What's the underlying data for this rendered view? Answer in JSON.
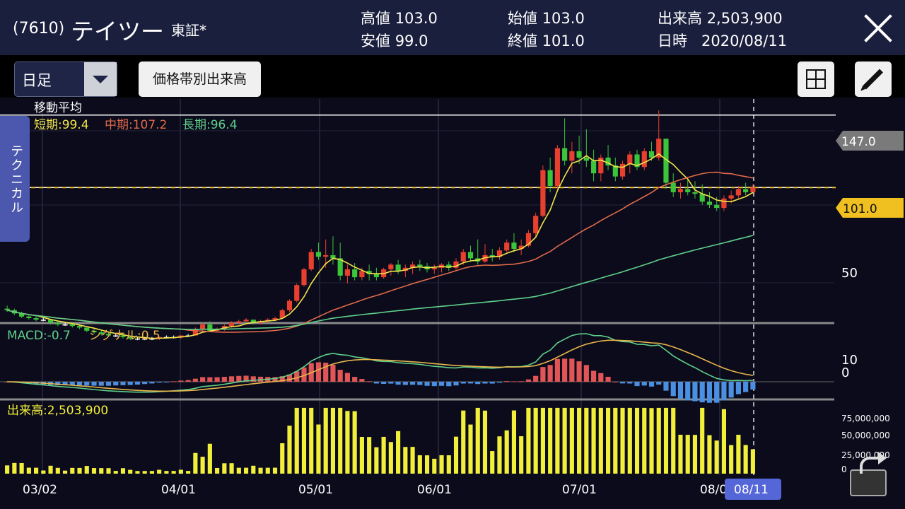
{
  "header": {
    "code": "(7610)",
    "name": "テイツー",
    "market": "東証*",
    "quotes": [
      {
        "label": "高値",
        "value": "103.0"
      },
      {
        "label": "安値",
        "value": "99.0"
      },
      {
        "label": "始値",
        "value": "103.0"
      },
      {
        "label": "終値",
        "value": "101.0"
      },
      {
        "label": "出来高",
        "value": "2,503,900"
      },
      {
        "label": "日時",
        "value": "2020/08/11"
      }
    ]
  },
  "toolbar": {
    "period": "日足",
    "volume_button": "価格帯別出来高"
  },
  "side_tab": "テクニカル",
  "colors": {
    "short_ma": "#f2e54a",
    "mid_ma": "#e06a4a",
    "long_ma": "#5fd08a",
    "up": "#e8402e",
    "down": "#3cc43a",
    "macd": "#5fd08a",
    "signal": "#e8b54a",
    "hist_pos": "#e05555",
    "hist_neg": "#4a8fe0",
    "volume": "#f2ef3a",
    "price_tag": "#f0c020"
  },
  "chart_data": {
    "type": "candlestick",
    "x_labels": [
      "03/02",
      "04/01",
      "05/01",
      "06/01",
      "07/01",
      "08/0"
    ],
    "cursor_label": "08/11",
    "price_panel": {
      "title": "移動平均",
      "ma_labels": [
        "短期:99.4",
        "中期:107.2",
        "長期:96.4"
      ],
      "y_ticks": [
        "50"
      ],
      "tags": {
        "high": "147.0",
        "current": "101.0"
      },
      "high_line": 147.0,
      "current_price": 101.0,
      "ylim": [
        18,
        155
      ],
      "candles": [
        [
          24,
          26,
          22,
          23
        ],
        [
          23,
          24,
          20,
          21
        ],
        [
          21,
          22,
          18,
          19
        ],
        [
          19,
          20,
          17,
          18
        ],
        [
          18,
          19,
          16,
          17
        ],
        [
          17,
          18,
          16,
          17
        ],
        [
          17,
          17,
          14,
          15
        ],
        [
          15,
          16,
          13,
          14
        ],
        [
          14,
          15,
          13,
          14
        ],
        [
          14,
          15,
          12,
          13
        ],
        [
          13,
          14,
          11,
          12
        ],
        [
          12,
          12,
          9,
          10
        ],
        [
          10,
          11,
          8,
          9
        ],
        [
          9,
          10,
          7,
          8
        ],
        [
          8,
          9,
          6,
          7
        ],
        [
          7,
          8,
          6,
          7
        ],
        [
          7,
          8,
          5,
          6
        ],
        [
          6,
          6,
          4,
          5
        ],
        [
          5,
          6,
          4,
          5
        ],
        [
          5,
          6,
          4,
          5
        ],
        [
          5,
          6,
          4,
          5
        ],
        [
          5,
          6,
          4,
          6
        ],
        [
          6,
          7,
          5,
          6
        ],
        [
          6,
          7,
          5,
          6
        ],
        [
          6,
          7,
          5,
          7
        ],
        [
          7,
          8,
          6,
          7
        ],
        [
          7,
          12,
          7,
          11
        ],
        [
          11,
          15,
          10,
          14
        ],
        [
          14,
          16,
          9,
          10
        ],
        [
          10,
          12,
          9,
          11
        ],
        [
          11,
          14,
          10,
          13
        ],
        [
          13,
          16,
          12,
          15
        ],
        [
          15,
          17,
          14,
          16
        ],
        [
          16,
          18,
          15,
          17
        ],
        [
          17,
          17,
          14,
          15
        ],
        [
          15,
          17,
          14,
          16
        ],
        [
          16,
          18,
          15,
          17
        ],
        [
          17,
          19,
          16,
          18
        ],
        [
          18,
          24,
          18,
          23
        ],
        [
          23,
          30,
          22,
          29
        ],
        [
          29,
          40,
          28,
          39
        ],
        [
          39,
          50,
          38,
          49
        ],
        [
          49,
          62,
          48,
          60
        ],
        [
          60,
          66,
          55,
          57
        ],
        [
          57,
          68,
          50,
          58
        ],
        [
          58,
          70,
          52,
          56
        ],
        [
          56,
          66,
          42,
          45
        ],
        [
          45,
          52,
          40,
          49
        ],
        [
          49,
          53,
          42,
          44
        ],
        [
          44,
          50,
          42,
          48
        ],
        [
          48,
          52,
          42,
          46
        ],
        [
          46,
          50,
          42,
          44
        ],
        [
          44,
          50,
          43,
          49
        ],
        [
          49,
          53,
          45,
          52
        ],
        [
          52,
          55,
          46,
          48
        ],
        [
          48,
          52,
          44,
          50
        ],
        [
          50,
          54,
          46,
          52
        ],
        [
          52,
          55,
          48,
          51
        ],
        [
          51,
          53,
          47,
          49
        ],
        [
          49,
          52,
          46,
          50
        ],
        [
          50,
          53,
          47,
          52
        ],
        [
          52,
          54,
          48,
          50
        ],
        [
          50,
          56,
          48,
          54
        ],
        [
          54,
          62,
          52,
          60
        ],
        [
          60,
          64,
          54,
          56
        ],
        [
          56,
          68,
          52,
          54
        ],
        [
          54,
          65,
          53,
          58
        ],
        [
          58,
          62,
          54,
          57
        ],
        [
          57,
          63,
          55,
          61
        ],
        [
          61,
          68,
          60,
          66
        ],
        [
          66,
          72,
          60,
          62
        ],
        [
          62,
          68,
          58,
          64
        ],
        [
          64,
          74,
          63,
          72
        ],
        [
          72,
          85,
          70,
          83
        ],
        [
          83,
          115,
          82,
          112
        ],
        [
          112,
          120,
          98,
          102
        ],
        [
          102,
          128,
          100,
          126
        ],
        [
          126,
          145,
          115,
          118
        ],
        [
          118,
          130,
          110,
          124
        ],
        [
          124,
          134,
          116,
          120
        ],
        [
          120,
          138,
          114,
          118
        ],
        [
          118,
          125,
          105,
          110
        ],
        [
          110,
          122,
          105,
          120
        ],
        [
          120,
          128,
          112,
          115
        ],
        [
          115,
          120,
          105,
          108
        ],
        [
          108,
          118,
          106,
          116
        ],
        [
          116,
          124,
          110,
          122
        ],
        [
          122,
          125,
          112,
          114
        ],
        [
          114,
          126,
          112,
          124
        ],
        [
          124,
          130,
          118,
          120
        ],
        [
          120,
          150,
          118,
          132
        ],
        [
          132,
          128,
          100,
          104
        ],
        [
          104,
          110,
          95,
          98
        ],
        [
          98,
          104,
          94,
          100
        ],
        [
          100,
          106,
          96,
          98
        ],
        [
          98,
          105,
          94,
          97
        ],
        [
          97,
          103,
          90,
          92
        ],
        [
          92,
          98,
          88,
          90
        ],
        [
          90,
          95,
          86,
          88
        ],
        [
          88,
          96,
          86,
          94
        ],
        [
          94,
          99,
          91,
          96
        ],
        [
          96,
          102,
          94,
          100
        ],
        [
          100,
          104,
          96,
          98
        ],
        [
          98,
          103,
          97,
          101
        ]
      ]
    },
    "macd_panel": {
      "label_macd": "MACD:-0.7",
      "label_signal": "シグナル:0.5",
      "y_ticks": [
        "10",
        "0"
      ]
    },
    "volume_panel": {
      "label": "出来高:2,503,900",
      "y_ticks": [
        "75,000,000",
        "50,000,000",
        "25,000,000",
        "0"
      ],
      "ylim": [
        0,
        90000000
      ]
    }
  }
}
